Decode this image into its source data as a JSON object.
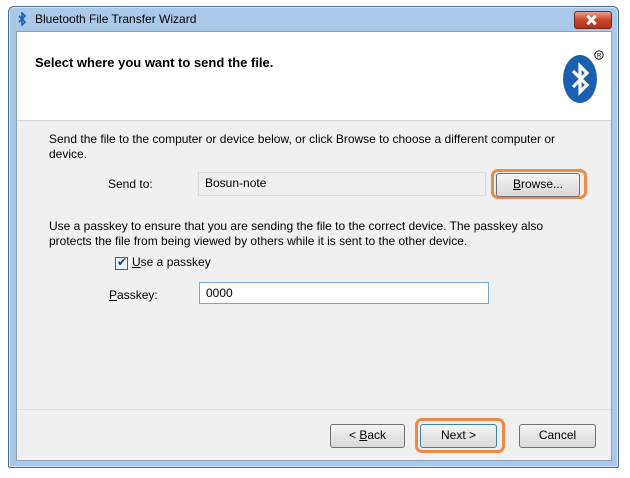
{
  "window": {
    "title": "Bluetooth File Transfer Wizard"
  },
  "header": {
    "title": "Select where you want to send the file."
  },
  "send": {
    "description": "Send the file to the computer or device below, or click Browse to choose a different computer or device.",
    "label_underlined": "",
    "label": "Send to:",
    "value": "Bosun-note",
    "browse_hotkey": "B",
    "browse_rest": "rowse..."
  },
  "passkey_section": {
    "description": "Use a passkey to ensure that you are sending the file to the correct device. The passkey also protects the file from being viewed by others while it is sent to the other device.",
    "checkbox_hotkey": "U",
    "checkbox_rest": "se a passkey",
    "checkbox_checked": true,
    "label_hotkey": "P",
    "label_rest": "asskey:",
    "value": "0000"
  },
  "buttons": {
    "back_prefix": "< ",
    "back_hotkey": "B",
    "back_rest": "ack",
    "next": "Next >",
    "cancel": "Cancel"
  },
  "colors": {
    "highlight": "#ee8a49",
    "bluetooth": "#1b5fb0"
  }
}
